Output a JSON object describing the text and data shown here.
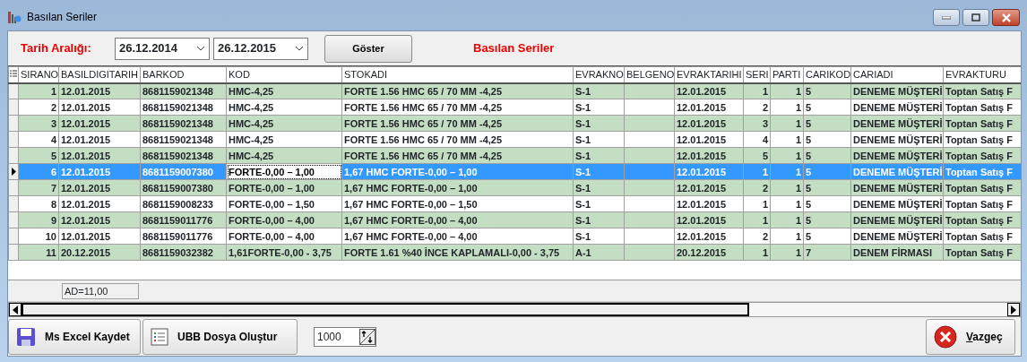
{
  "window": {
    "title": "Basılan Seriler"
  },
  "filter": {
    "label": "Tarih Aralığı:",
    "start_date": "26.12.2014",
    "end_date": "26.12.2015",
    "show_button": "Göster",
    "heading": "Basılan Seriler"
  },
  "table": {
    "columns": [
      {
        "label": "SIRANO"
      },
      {
        "label": "BASILDIGITARIH"
      },
      {
        "label": "BARKOD"
      },
      {
        "label": "KOD"
      },
      {
        "label": "STOKADI"
      },
      {
        "label": "EVRAKNO"
      },
      {
        "label": "BELGENO"
      },
      {
        "label": "EVRAKTARIHI"
      },
      {
        "label": "SERI"
      },
      {
        "label": "PARTI"
      },
      {
        "label": "CARIKOD"
      },
      {
        "label": "CARIADI"
      },
      {
        "label": "EVRAKTURU"
      }
    ],
    "rows": [
      {
        "selected": false,
        "sirano": "1",
        "tarih": "12.01.2015",
        "barkod": "8681159021348",
        "kod": "HMC-4,25",
        "stokadi": "FORTE  1.56 HMC 65 / 70 MM -4,25",
        "evrakno": "S-1",
        "evraktarihi": "12.01.2015",
        "seri": "1",
        "parti": "1",
        "carikod": "5",
        "cariadi": "DENEME MÜŞTERİ",
        "evrakturu": "Toptan Satış F"
      },
      {
        "selected": false,
        "sirano": "2",
        "tarih": "12.01.2015",
        "barkod": "8681159021348",
        "kod": "HMC-4,25",
        "stokadi": "FORTE  1.56 HMC 65 / 70 MM -4,25",
        "evrakno": "S-1",
        "evraktarihi": "12.01.2015",
        "seri": "2",
        "parti": "1",
        "carikod": "5",
        "cariadi": "DENEME MÜŞTERİ",
        "evrakturu": "Toptan Satış F"
      },
      {
        "selected": false,
        "sirano": "3",
        "tarih": "12.01.2015",
        "barkod": "8681159021348",
        "kod": "HMC-4,25",
        "stokadi": "FORTE  1.56 HMC 65 / 70 MM -4,25",
        "evrakno": "S-1",
        "evraktarihi": "12.01.2015",
        "seri": "3",
        "parti": "1",
        "carikod": "5",
        "cariadi": "DENEME MÜŞTERİ",
        "evrakturu": "Toptan Satış F"
      },
      {
        "selected": false,
        "sirano": "4",
        "tarih": "12.01.2015",
        "barkod": "8681159021348",
        "kod": "HMC-4,25",
        "stokadi": "FORTE  1.56 HMC 65 / 70 MM -4,25",
        "evrakno": "S-1",
        "evraktarihi": "12.01.2015",
        "seri": "4",
        "parti": "1",
        "carikod": "5",
        "cariadi": "DENEME MÜŞTERİ",
        "evrakturu": "Toptan Satış F"
      },
      {
        "selected": false,
        "sirano": "5",
        "tarih": "12.01.2015",
        "barkod": "8681159021348",
        "kod": "HMC-4,25",
        "stokadi": "FORTE  1.56 HMC 65 / 70 MM -4,25",
        "evrakno": "S-1",
        "evraktarihi": "12.01.2015",
        "seri": "5",
        "parti": "1",
        "carikod": "5",
        "cariadi": "DENEME MÜŞTERİ",
        "evrakturu": "Toptan Satış F"
      },
      {
        "selected": true,
        "sirano": "6",
        "tarih": "12.01.2015",
        "barkod": "8681159007380",
        "kod": "FORTE-0,00 – 1,00",
        "stokadi": "1,67 HMC FORTE-0,00 – 1,00",
        "evrakno": "S-1",
        "evraktarihi": "12.01.2015",
        "seri": "1",
        "parti": "1",
        "carikod": "5",
        "cariadi": "DENEME MÜŞTERİ",
        "evrakturu": "Toptan Satış F"
      },
      {
        "selected": false,
        "sirano": "7",
        "tarih": "12.01.2015",
        "barkod": "8681159007380",
        "kod": "FORTE-0,00 – 1,00",
        "stokadi": "1,67 HMC FORTE-0,00 – 1,00",
        "evrakno": "S-1",
        "evraktarihi": "12.01.2015",
        "seri": "2",
        "parti": "1",
        "carikod": "5",
        "cariadi": "DENEME MÜŞTERİ",
        "evrakturu": "Toptan Satış F"
      },
      {
        "selected": false,
        "sirano": "8",
        "tarih": "12.01.2015",
        "barkod": "8681159008233",
        "kod": "FORTE-0,00 – 1,50",
        "stokadi": "1,67 HMC FORTE-0,00 – 1,50",
        "evrakno": "S-1",
        "evraktarihi": "12.01.2015",
        "seri": "1",
        "parti": "1",
        "carikod": "5",
        "cariadi": "DENEME MÜŞTERİ",
        "evrakturu": "Toptan Satış F"
      },
      {
        "selected": false,
        "sirano": "9",
        "tarih": "12.01.2015",
        "barkod": "8681159011776",
        "kod": "FORTE-0,00 – 4,00",
        "stokadi": "1,67 HMC FORTE-0,00 – 4,00",
        "evrakno": "S-1",
        "evraktarihi": "12.01.2015",
        "seri": "1",
        "parti": "1",
        "carikod": "5",
        "cariadi": "DENEME MÜŞTERİ",
        "evrakturu": "Toptan Satış F"
      },
      {
        "selected": false,
        "sirano": "10",
        "tarih": "12.01.2015",
        "barkod": "8681159011776",
        "kod": "FORTE-0,00 – 4,00",
        "stokadi": "1,67 HMC FORTE-0,00 – 4,00",
        "evrakno": "S-1",
        "evraktarihi": "12.01.2015",
        "seri": "2",
        "parti": "1",
        "carikod": "5",
        "cariadi": "DENEME MÜŞTERİ",
        "evrakturu": "Toptan Satış F"
      },
      {
        "selected": false,
        "sirano": "11",
        "tarih": "20.12.2015",
        "barkod": "8681159032382",
        "kod": "1,61FORTE-0,00 - 3,75",
        "stokadi": "FORTE 1.61 %40 İNCE KAPLAMALI-0,00 - 3,75",
        "evrakno": "A-1",
        "evraktarihi": "20.12.2015",
        "seri": "1",
        "parti": "1",
        "carikod": "7",
        "cariadi": "DENEM FİRMASI",
        "evrakturu": "Toptan Satış F"
      }
    ],
    "summary": "AD=11,00"
  },
  "buttons": {
    "excel": "Ms Excel Kaydet",
    "ubb": "UBB Dosya Oluştur",
    "count": "1000",
    "cancel": "Vazgeç"
  }
}
